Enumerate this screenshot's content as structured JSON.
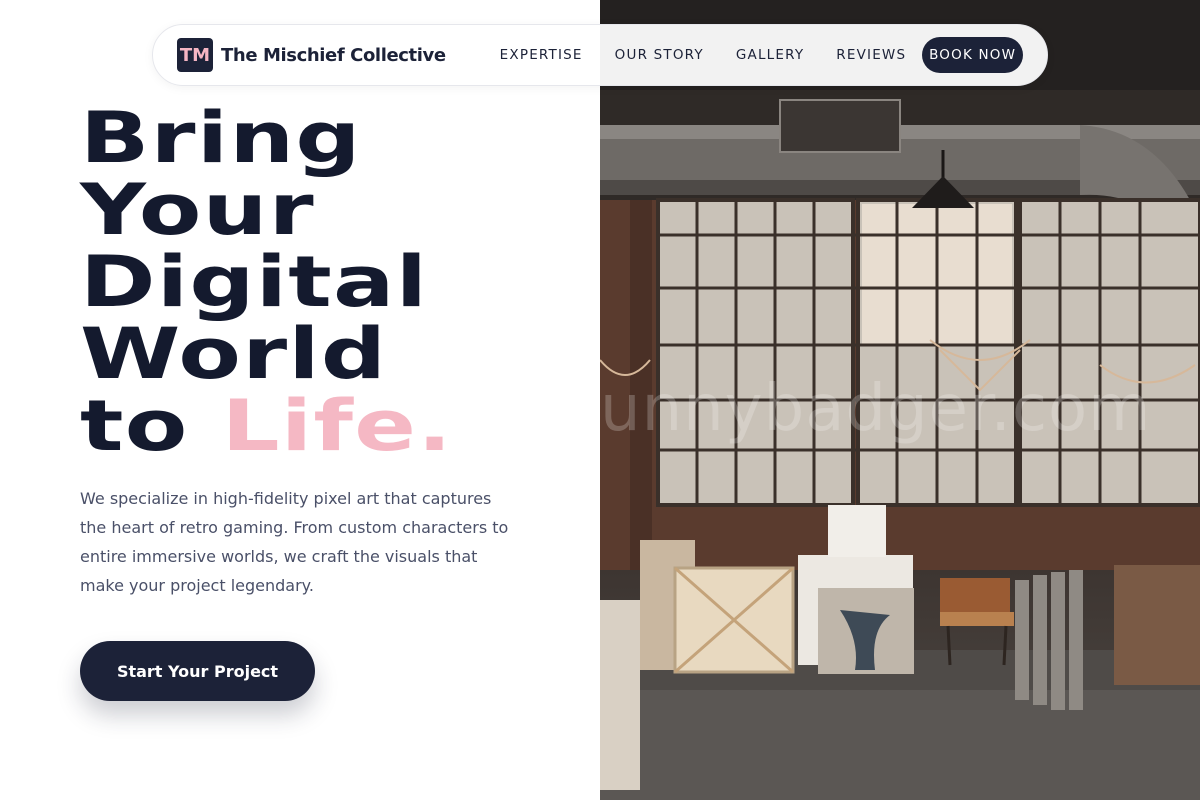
{
  "nav": {
    "logo_initials": "TM",
    "brand_name": "The Mischief Collective",
    "links": [
      {
        "label": "EXPERTISE"
      },
      {
        "label": "OUR STORY"
      },
      {
        "label": "GALLERY"
      },
      {
        "label": "REVIEWS"
      }
    ],
    "cta_label": "BOOK NOW"
  },
  "hero": {
    "headline_lines": [
      "Bring",
      "Your",
      "Digital",
      "World"
    ],
    "headline_last_prefix": "to",
    "headline_accent": "Life.",
    "description": "We specialize in high-fidelity pixel art that captures the heart of retro gaming. From custom characters to entire immersive worlds, we craft the visuals that make your project legendary.",
    "cta_label": "Start Your Project"
  },
  "photo": {
    "watermark": "unnybadger.com",
    "subject": "industrial loft art studio with chandeliers and canvases"
  },
  "colors": {
    "navy": "#1c2238",
    "accent_pink": "#f5b8c4",
    "body_text": "#4a5068"
  }
}
